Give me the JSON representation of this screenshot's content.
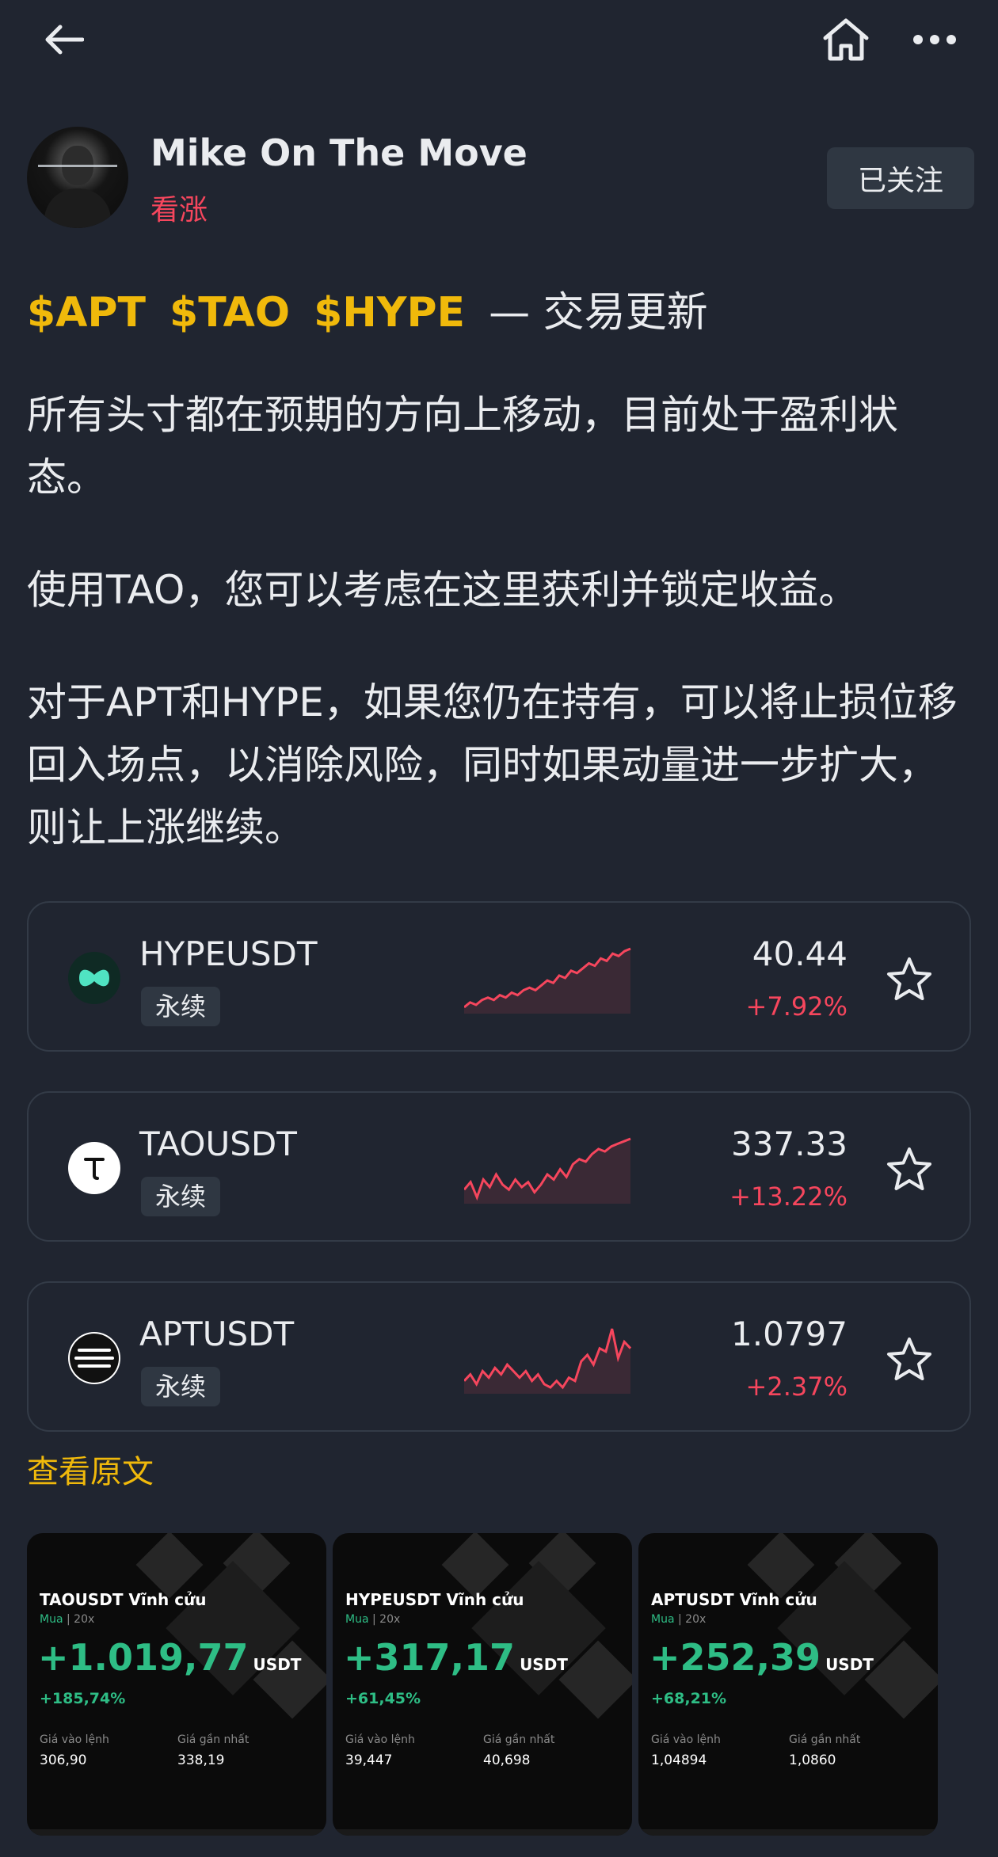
{
  "header": {
    "back_icon": "arrow-left-icon",
    "home_icon": "home-icon",
    "more_icon": "more-dots-icon"
  },
  "author": {
    "name": "Mike On The Move",
    "tag": "看涨",
    "follow_label": "已关注"
  },
  "post": {
    "tickers": [
      "$APT",
      "$TAO",
      "$HYPE"
    ],
    "headline_rest": "— 交易更新",
    "paragraphs": [
      "所有头寸都在预期的方向上移动，目前处于盈利状态。",
      "使用TAO，您可以考虑在这里获利并锁定收益。",
      "对于APT和HYPE，如果您仍在持有，可以将止损位移回入场点，以消除风险，同时如果动量进一步扩大，则让上涨继续。"
    ],
    "view_original": "查看原文"
  },
  "markets": [
    {
      "symbol": "HYPEUSDT",
      "type": "永续",
      "price": "40.44",
      "change": "+7.92%",
      "spark": [
        3,
        5,
        4,
        6,
        7,
        6,
        8,
        7,
        9,
        8,
        10,
        11,
        10,
        12,
        14,
        13,
        16,
        15,
        18,
        17,
        19,
        21,
        20,
        23,
        22,
        25,
        24,
        26,
        27
      ]
    },
    {
      "symbol": "TAOUSDT",
      "type": "永续",
      "price": "337.33",
      "change": "+13.22%",
      "spark": [
        8,
        11,
        5,
        12,
        9,
        14,
        10,
        8,
        12,
        9,
        11,
        7,
        10,
        14,
        12,
        16,
        13,
        18,
        20,
        19,
        22,
        24,
        23,
        25,
        26,
        27,
        28
      ]
    },
    {
      "symbol": "APTUSDT",
      "type": "永续",
      "price": "1.0797",
      "change": "+2.37%",
      "spark": [
        6,
        8,
        5,
        9,
        7,
        10,
        8,
        11,
        9,
        7,
        9,
        6,
        8,
        5,
        4,
        6,
        4,
        7,
        6,
        12,
        14,
        11,
        16,
        15,
        22,
        13,
        18,
        16
      ]
    }
  ],
  "colors": {
    "up": "#f6465d",
    "accent": "#f0b90b",
    "pnl": "#2ebd85"
  },
  "shares": [
    {
      "title": "TAOUSDT Vĩnh cửu",
      "side": "Mua",
      "leverage": "20x",
      "pnl": "+1.019,77",
      "unit": "USDT",
      "roi": "+185,74%",
      "entry_label": "Giá vào lệnh",
      "entry": "306,90",
      "last_label": "Giá gần nhất",
      "last": "338,19"
    },
    {
      "title": "HYPEUSDT Vĩnh cửu",
      "side": "Mua",
      "leverage": "20x",
      "pnl": "+317,17",
      "unit": "USDT",
      "roi": "+61,45%",
      "entry_label": "Giá vào lệnh",
      "entry": "39,447",
      "last_label": "Giá gần nhất",
      "last": "40,698"
    },
    {
      "title": "APTUSDT Vĩnh cửu",
      "side": "Mua",
      "leverage": "20x",
      "pnl": "+252,39",
      "unit": "USDT",
      "roi": "+68,21%",
      "entry_label": "Giá vào lệnh",
      "entry": "1,04894",
      "last_label": "Giá gần nhất",
      "last": "1,0860"
    }
  ]
}
